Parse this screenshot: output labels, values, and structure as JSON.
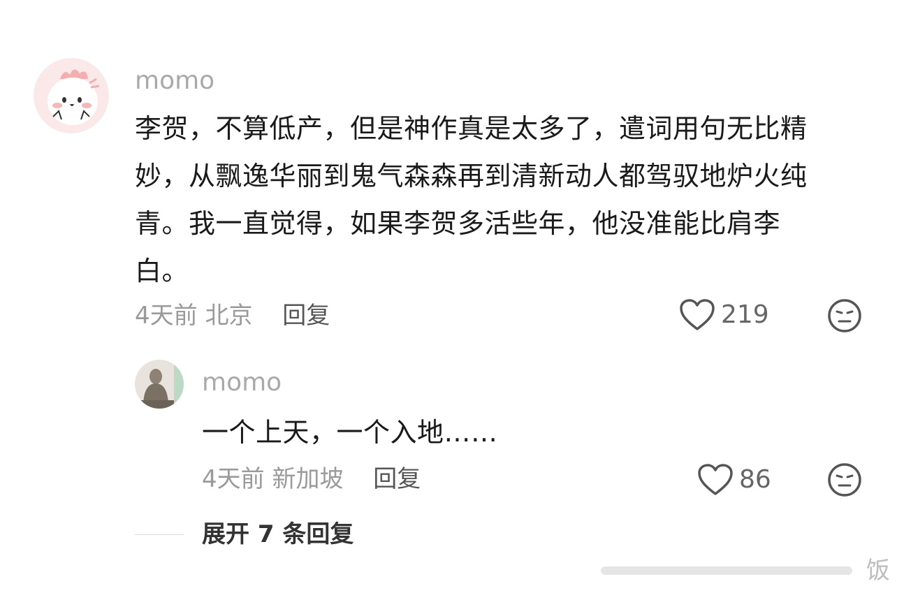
{
  "comment": {
    "username": "momo",
    "lines": [
      "李贺，不算低产，但是神作真是太多了，遣词用句无比精",
      "妙，从飘逸华丽到鬼气森森再到清新动人都驾驭地炉火纯",
      "青。我一直觉得，如果李贺多活些年，他没准能比肩李",
      "白。"
    ],
    "time": "4天前",
    "location": "北京",
    "reply_label": "回复",
    "like_count": "219",
    "reaction_icon": "meh-face-icon"
  },
  "reply": {
    "username": "momo",
    "text": "一个上天，一个入地……",
    "time": "4天前",
    "location": "新加坡",
    "reply_label": "回复",
    "like_count": "86",
    "reaction_icon": "meh-face-icon"
  },
  "expand_label": "展开 7 条回复",
  "watermark": "饭"
}
